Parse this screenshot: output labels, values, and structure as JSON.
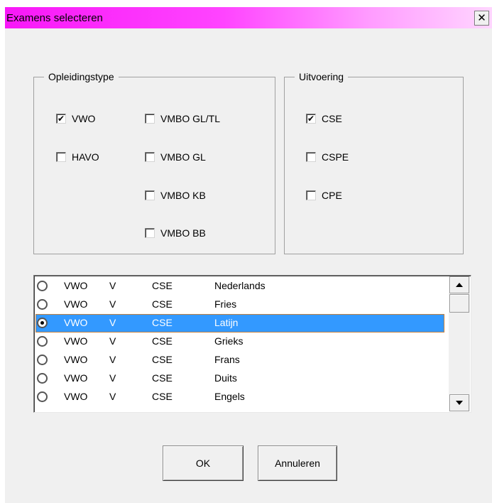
{
  "window": {
    "title": "Examens selecteren",
    "close_glyph": "✕"
  },
  "opleidingstype": {
    "legend": "Opleidingstype",
    "items": [
      {
        "label": "VWO",
        "checked": true
      },
      {
        "label": "HAVO",
        "checked": false
      },
      {
        "label": "VMBO GL/TL",
        "checked": false
      },
      {
        "label": "VMBO GL",
        "checked": false
      },
      {
        "label": "VMBO KB",
        "checked": false
      },
      {
        "label": "VMBO BB",
        "checked": false
      }
    ]
  },
  "uitvoering": {
    "legend": "Uitvoering",
    "items": [
      {
        "label": "CSE",
        "checked": true
      },
      {
        "label": "CSPE",
        "checked": false
      },
      {
        "label": "CPE",
        "checked": false
      }
    ]
  },
  "exam_list": {
    "rows": [
      {
        "type": "VWO",
        "code": "V",
        "uitvoering": "CSE",
        "subject": "Nederlands",
        "selected": false
      },
      {
        "type": "VWO",
        "code": "V",
        "uitvoering": "CSE",
        "subject": "Fries",
        "selected": false
      },
      {
        "type": "VWO",
        "code": "V",
        "uitvoering": "CSE",
        "subject": "Latijn",
        "selected": true
      },
      {
        "type": "VWO",
        "code": "V",
        "uitvoering": "CSE",
        "subject": "Grieks",
        "selected": false
      },
      {
        "type": "VWO",
        "code": "V",
        "uitvoering": "CSE",
        "subject": "Frans",
        "selected": false
      },
      {
        "type": "VWO",
        "code": "V",
        "uitvoering": "CSE",
        "subject": "Duits",
        "selected": false
      },
      {
        "type": "VWO",
        "code": "V",
        "uitvoering": "CSE",
        "subject": "Engels",
        "selected": false
      }
    ]
  },
  "buttons": {
    "ok": "OK",
    "cancel": "Annuleren"
  },
  "colors": {
    "title_gradient_start": "#f818f8",
    "selection": "#3399ff"
  },
  "check_glyph": "✔"
}
